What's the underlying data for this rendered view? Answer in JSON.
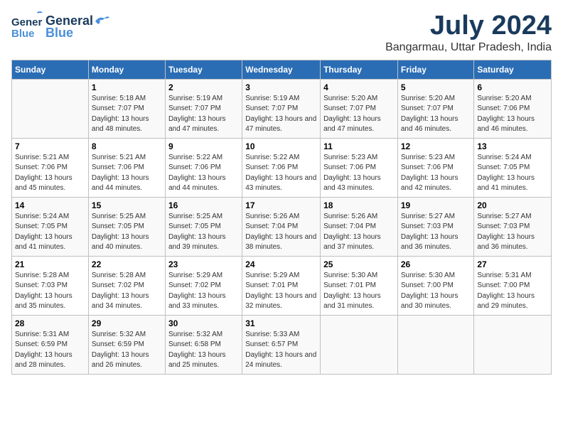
{
  "header": {
    "logo_line1": "General",
    "logo_line2": "Blue",
    "month_year": "July 2024",
    "location": "Bangarmau, Uttar Pradesh, India"
  },
  "columns": [
    "Sunday",
    "Monday",
    "Tuesday",
    "Wednesday",
    "Thursday",
    "Friday",
    "Saturday"
  ],
  "weeks": [
    [
      {
        "day": "",
        "sunrise": "",
        "sunset": "",
        "daylight": ""
      },
      {
        "day": "1",
        "sunrise": "Sunrise: 5:18 AM",
        "sunset": "Sunset: 7:07 PM",
        "daylight": "Daylight: 13 hours and 48 minutes."
      },
      {
        "day": "2",
        "sunrise": "Sunrise: 5:19 AM",
        "sunset": "Sunset: 7:07 PM",
        "daylight": "Daylight: 13 hours and 47 minutes."
      },
      {
        "day": "3",
        "sunrise": "Sunrise: 5:19 AM",
        "sunset": "Sunset: 7:07 PM",
        "daylight": "Daylight: 13 hours and 47 minutes."
      },
      {
        "day": "4",
        "sunrise": "Sunrise: 5:20 AM",
        "sunset": "Sunset: 7:07 PM",
        "daylight": "Daylight: 13 hours and 47 minutes."
      },
      {
        "day": "5",
        "sunrise": "Sunrise: 5:20 AM",
        "sunset": "Sunset: 7:07 PM",
        "daylight": "Daylight: 13 hours and 46 minutes."
      },
      {
        "day": "6",
        "sunrise": "Sunrise: 5:20 AM",
        "sunset": "Sunset: 7:06 PM",
        "daylight": "Daylight: 13 hours and 46 minutes."
      }
    ],
    [
      {
        "day": "7",
        "sunrise": "Sunrise: 5:21 AM",
        "sunset": "Sunset: 7:06 PM",
        "daylight": "Daylight: 13 hours and 45 minutes."
      },
      {
        "day": "8",
        "sunrise": "Sunrise: 5:21 AM",
        "sunset": "Sunset: 7:06 PM",
        "daylight": "Daylight: 13 hours and 44 minutes."
      },
      {
        "day": "9",
        "sunrise": "Sunrise: 5:22 AM",
        "sunset": "Sunset: 7:06 PM",
        "daylight": "Daylight: 13 hours and 44 minutes."
      },
      {
        "day": "10",
        "sunrise": "Sunrise: 5:22 AM",
        "sunset": "Sunset: 7:06 PM",
        "daylight": "Daylight: 13 hours and 43 minutes."
      },
      {
        "day": "11",
        "sunrise": "Sunrise: 5:23 AM",
        "sunset": "Sunset: 7:06 PM",
        "daylight": "Daylight: 13 hours and 43 minutes."
      },
      {
        "day": "12",
        "sunrise": "Sunrise: 5:23 AM",
        "sunset": "Sunset: 7:06 PM",
        "daylight": "Daylight: 13 hours and 42 minutes."
      },
      {
        "day": "13",
        "sunrise": "Sunrise: 5:24 AM",
        "sunset": "Sunset: 7:05 PM",
        "daylight": "Daylight: 13 hours and 41 minutes."
      }
    ],
    [
      {
        "day": "14",
        "sunrise": "Sunrise: 5:24 AM",
        "sunset": "Sunset: 7:05 PM",
        "daylight": "Daylight: 13 hours and 41 minutes."
      },
      {
        "day": "15",
        "sunrise": "Sunrise: 5:25 AM",
        "sunset": "Sunset: 7:05 PM",
        "daylight": "Daylight: 13 hours and 40 minutes."
      },
      {
        "day": "16",
        "sunrise": "Sunrise: 5:25 AM",
        "sunset": "Sunset: 7:05 PM",
        "daylight": "Daylight: 13 hours and 39 minutes."
      },
      {
        "day": "17",
        "sunrise": "Sunrise: 5:26 AM",
        "sunset": "Sunset: 7:04 PM",
        "daylight": "Daylight: 13 hours and 38 minutes."
      },
      {
        "day": "18",
        "sunrise": "Sunrise: 5:26 AM",
        "sunset": "Sunset: 7:04 PM",
        "daylight": "Daylight: 13 hours and 37 minutes."
      },
      {
        "day": "19",
        "sunrise": "Sunrise: 5:27 AM",
        "sunset": "Sunset: 7:03 PM",
        "daylight": "Daylight: 13 hours and 36 minutes."
      },
      {
        "day": "20",
        "sunrise": "Sunrise: 5:27 AM",
        "sunset": "Sunset: 7:03 PM",
        "daylight": "Daylight: 13 hours and 36 minutes."
      }
    ],
    [
      {
        "day": "21",
        "sunrise": "Sunrise: 5:28 AM",
        "sunset": "Sunset: 7:03 PM",
        "daylight": "Daylight: 13 hours and 35 minutes."
      },
      {
        "day": "22",
        "sunrise": "Sunrise: 5:28 AM",
        "sunset": "Sunset: 7:02 PM",
        "daylight": "Daylight: 13 hours and 34 minutes."
      },
      {
        "day": "23",
        "sunrise": "Sunrise: 5:29 AM",
        "sunset": "Sunset: 7:02 PM",
        "daylight": "Daylight: 13 hours and 33 minutes."
      },
      {
        "day": "24",
        "sunrise": "Sunrise: 5:29 AM",
        "sunset": "Sunset: 7:01 PM",
        "daylight": "Daylight: 13 hours and 32 minutes."
      },
      {
        "day": "25",
        "sunrise": "Sunrise: 5:30 AM",
        "sunset": "Sunset: 7:01 PM",
        "daylight": "Daylight: 13 hours and 31 minutes."
      },
      {
        "day": "26",
        "sunrise": "Sunrise: 5:30 AM",
        "sunset": "Sunset: 7:00 PM",
        "daylight": "Daylight: 13 hours and 30 minutes."
      },
      {
        "day": "27",
        "sunrise": "Sunrise: 5:31 AM",
        "sunset": "Sunset: 7:00 PM",
        "daylight": "Daylight: 13 hours and 29 minutes."
      }
    ],
    [
      {
        "day": "28",
        "sunrise": "Sunrise: 5:31 AM",
        "sunset": "Sunset: 6:59 PM",
        "daylight": "Daylight: 13 hours and 28 minutes."
      },
      {
        "day": "29",
        "sunrise": "Sunrise: 5:32 AM",
        "sunset": "Sunset: 6:59 PM",
        "daylight": "Daylight: 13 hours and 26 minutes."
      },
      {
        "day": "30",
        "sunrise": "Sunrise: 5:32 AM",
        "sunset": "Sunset: 6:58 PM",
        "daylight": "Daylight: 13 hours and 25 minutes."
      },
      {
        "day": "31",
        "sunrise": "Sunrise: 5:33 AM",
        "sunset": "Sunset: 6:57 PM",
        "daylight": "Daylight: 13 hours and 24 minutes."
      },
      {
        "day": "",
        "sunrise": "",
        "sunset": "",
        "daylight": ""
      },
      {
        "day": "",
        "sunrise": "",
        "sunset": "",
        "daylight": ""
      },
      {
        "day": "",
        "sunrise": "",
        "sunset": "",
        "daylight": ""
      }
    ]
  ]
}
